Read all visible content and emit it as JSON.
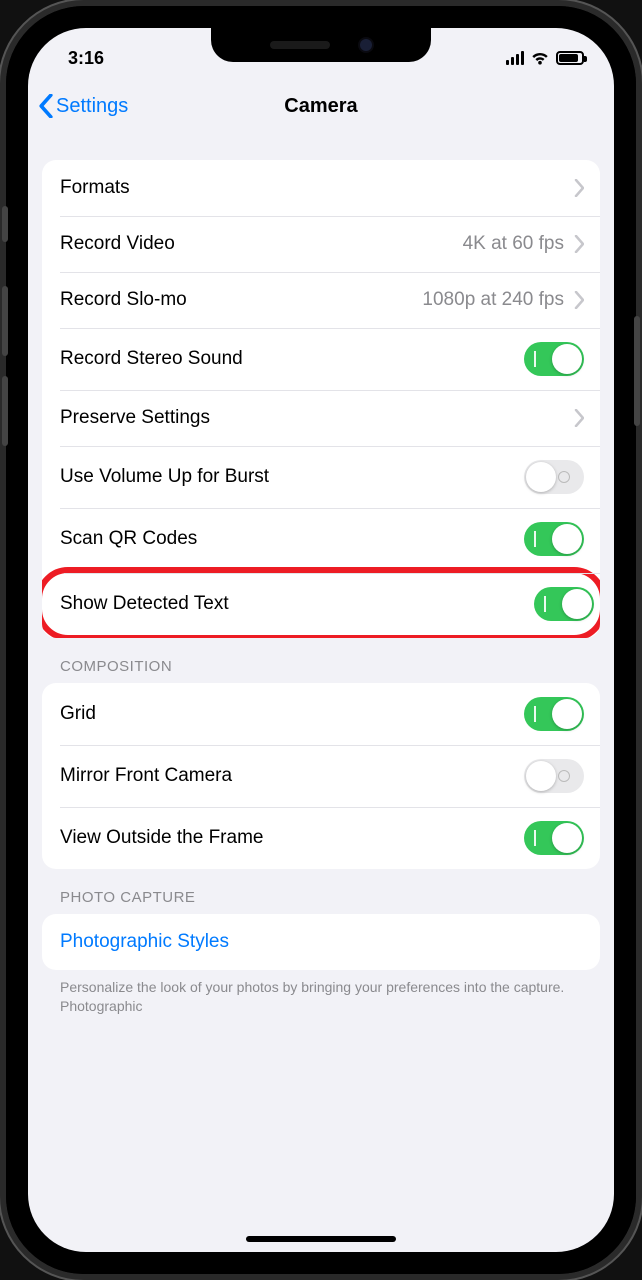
{
  "status": {
    "time": "3:16"
  },
  "nav": {
    "back_label": "Settings",
    "title": "Camera"
  },
  "group1": {
    "items": [
      {
        "label": "Formats",
        "type": "disclosure"
      },
      {
        "label": "Record Video",
        "value": "4K at 60 fps",
        "type": "disclosure"
      },
      {
        "label": "Record Slo-mo",
        "value": "1080p at 240 fps",
        "type": "disclosure"
      },
      {
        "label": "Record Stereo Sound",
        "type": "toggle",
        "on": true
      },
      {
        "label": "Preserve Settings",
        "type": "disclosure"
      },
      {
        "label": "Use Volume Up for Burst",
        "type": "toggle",
        "on": false
      },
      {
        "label": "Scan QR Codes",
        "type": "toggle",
        "on": true
      },
      {
        "label": "Show Detected Text",
        "type": "toggle",
        "on": true,
        "highlighted": true
      }
    ]
  },
  "group2": {
    "header": "COMPOSITION",
    "items": [
      {
        "label": "Grid",
        "type": "toggle",
        "on": true
      },
      {
        "label": "Mirror Front Camera",
        "type": "toggle",
        "on": false
      },
      {
        "label": "View Outside the Frame",
        "type": "toggle",
        "on": true
      }
    ]
  },
  "group3": {
    "header": "PHOTO CAPTURE",
    "items": [
      {
        "label": "Photographic Styles",
        "type": "link"
      }
    ],
    "footer": "Personalize the look of your photos by bringing your preferences into the capture. Photographic"
  }
}
